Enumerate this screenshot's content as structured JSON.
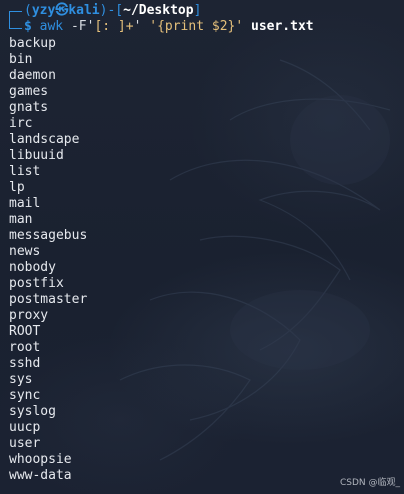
{
  "prompt": {
    "open_paren": "(",
    "user": "yzy",
    "at_symbol": "㉿",
    "host": "kali",
    "close_paren": ")",
    "dash": "-",
    "open_bracket": "[",
    "cwd": "~/Desktop",
    "close_bracket": "]",
    "dollar": "$"
  },
  "command": {
    "program": "awk",
    "flag_prefix": "-F'",
    "flag_value": "[: ]+",
    "flag_suffix": "'",
    "program_text": "'{print $2}'",
    "file": "user.txt"
  },
  "output_lines": [
    "backup",
    "bin",
    "daemon",
    "games",
    "gnats",
    "irc",
    "landscape",
    "libuuid",
    "list",
    "lp",
    "mail",
    "man",
    "messagebus",
    "news",
    "nobody",
    "postfix",
    "postmaster",
    "proxy",
    "ROOT",
    "root",
    "sshd",
    "sys",
    "sync",
    "syslog",
    "uucp",
    "user",
    "whoopsie",
    "www-data"
  ],
  "watermark": "CSDN @临观_",
  "colors": {
    "prompt_blue": "#2f8fe0",
    "background": "#1c2331",
    "output_text": "#e6e9ee"
  }
}
